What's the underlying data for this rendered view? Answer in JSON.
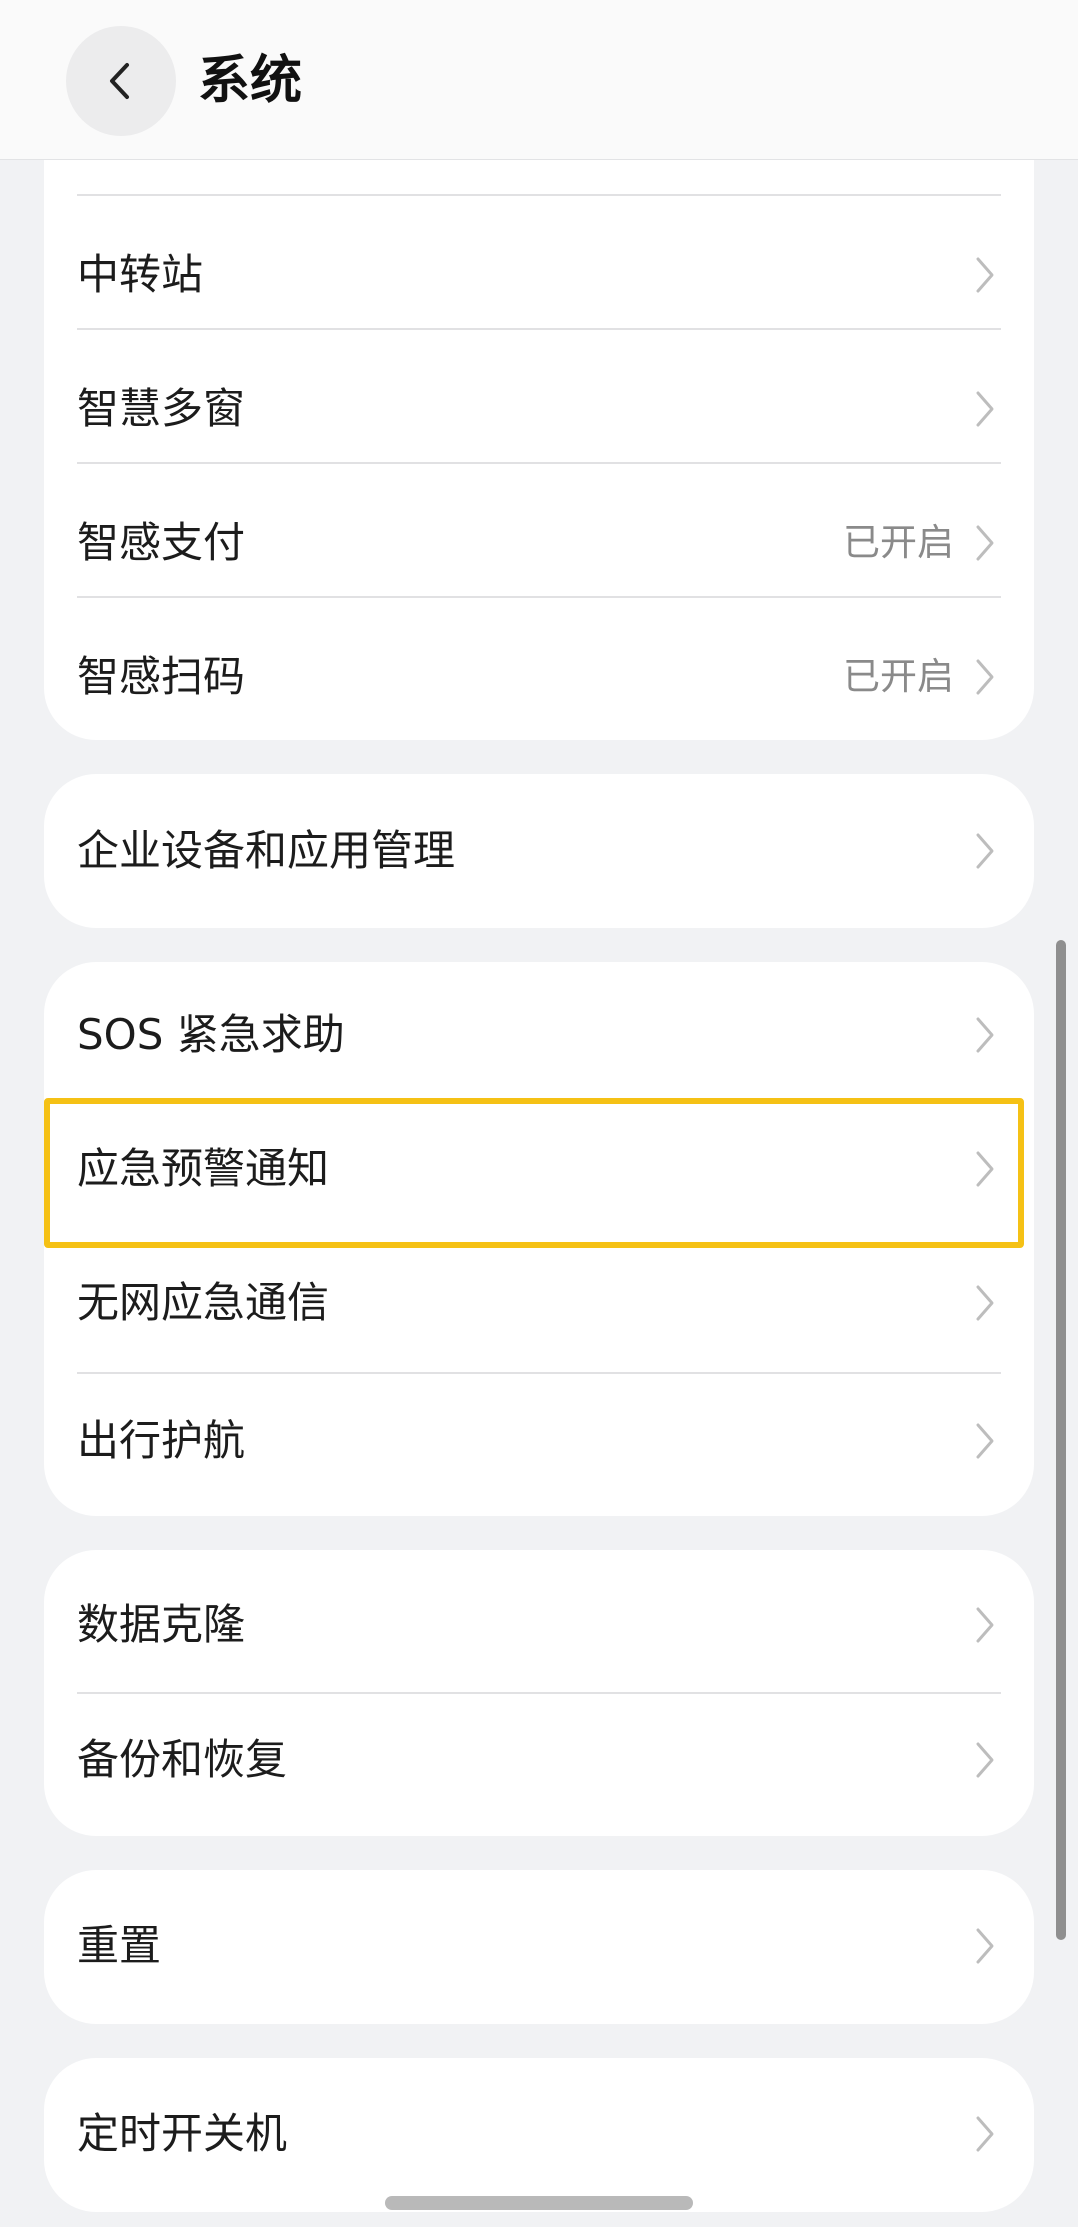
{
  "header": {
    "title": "系统",
    "back_icon": "chevron-left-icon"
  },
  "groups": [
    {
      "items": [
        {
          "label": "中转站",
          "value": ""
        },
        {
          "label": "智慧多窗",
          "value": ""
        },
        {
          "label": "智感支付",
          "value": "已开启"
        },
        {
          "label": "智感扫码",
          "value": "已开启"
        }
      ]
    },
    {
      "items": [
        {
          "label": "企业设备和应用管理",
          "value": ""
        }
      ]
    },
    {
      "items": [
        {
          "label": "SOS 紧急求助",
          "value": ""
        },
        {
          "label": "应急预警通知",
          "value": ""
        },
        {
          "label": "无网应急通信",
          "value": ""
        },
        {
          "label": "出行护航",
          "value": ""
        }
      ]
    },
    {
      "items": [
        {
          "label": "数据克隆",
          "value": ""
        },
        {
          "label": "备份和恢复",
          "value": ""
        }
      ]
    },
    {
      "items": [
        {
          "label": "重置",
          "value": ""
        }
      ]
    },
    {
      "items": [
        {
          "label": "定时开关机",
          "value": ""
        }
      ]
    }
  ],
  "colors": {
    "background": "#f1f2f4",
    "card": "#ffffff",
    "highlight": "#f5c115",
    "value_text": "#8a8a8a"
  }
}
